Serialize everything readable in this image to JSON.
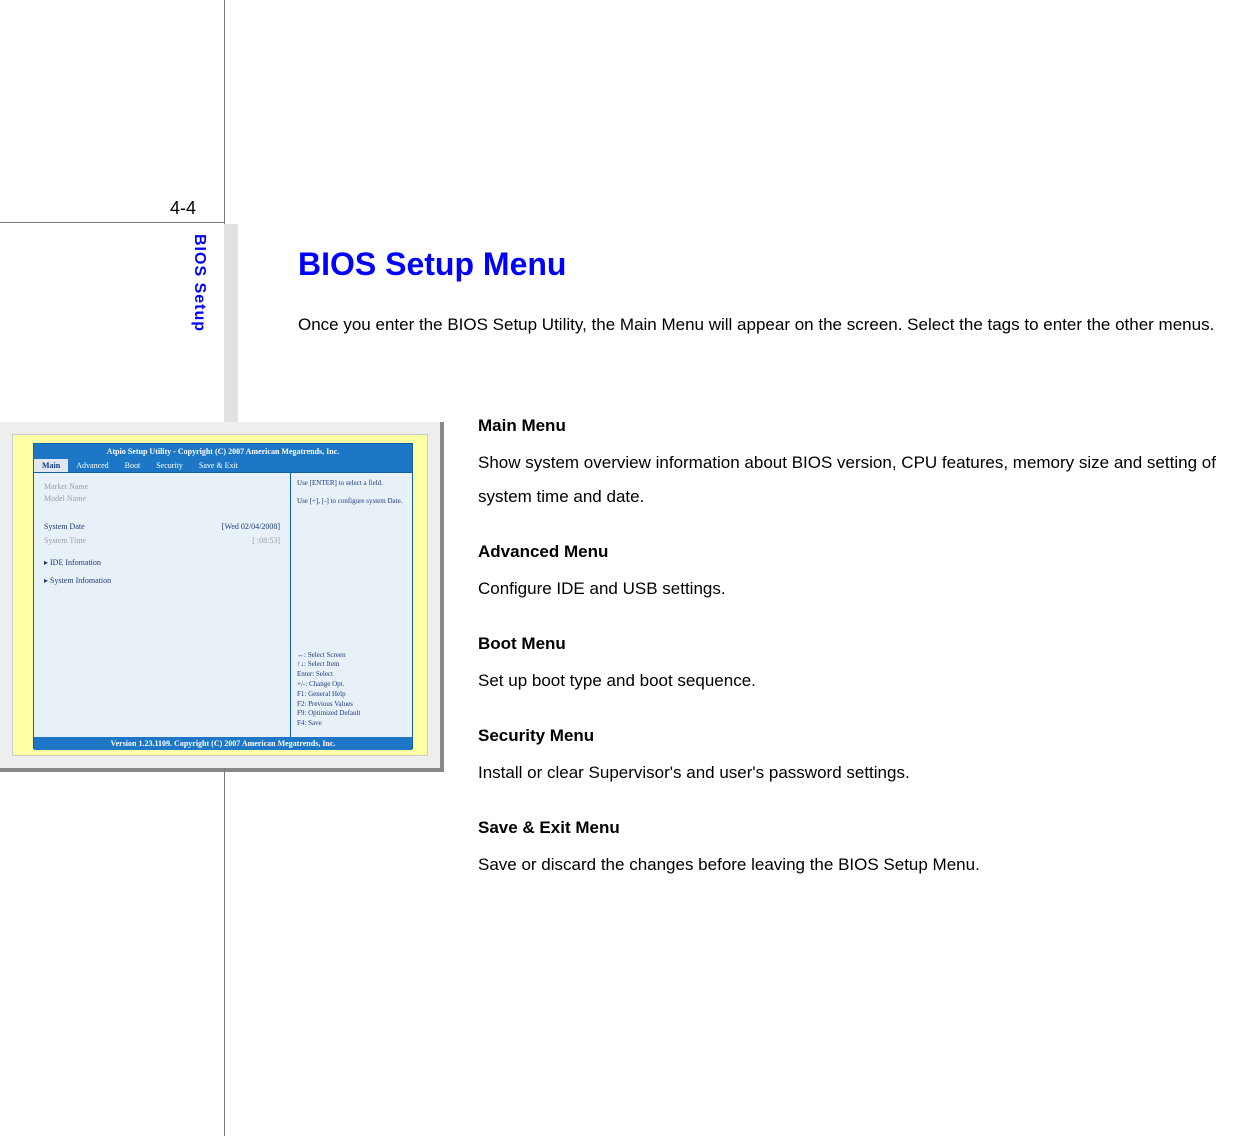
{
  "page_number": "4-4",
  "side_label": "BIOS Setup",
  "title": "BIOS Setup Menu",
  "intro": "Once you enter the BIOS Setup Utility, the Main Menu will appear on the screen.    Select the tags to enter the other menus.",
  "menus": [
    {
      "heading": "Main Menu",
      "text": "Show system overview information about BIOS version, CPU features, memory size and setting of system time and date."
    },
    {
      "heading": "Advanced Menu",
      "text": "Configure IDE and USB settings."
    },
    {
      "heading": "Boot Menu",
      "text": "Set up boot type and boot sequence."
    },
    {
      "heading": "Security Menu",
      "text": "Install or clear Supervisor's and user's password settings."
    },
    {
      "heading": "Save & Exit Menu",
      "text": "Save or discard the changes before leaving the BIOS Setup Menu."
    }
  ],
  "bios": {
    "title": "Atpio Setup Utility - Copyright (C) 2007 American Megatrends, Inc.",
    "tabs": [
      "Main",
      "Advanced",
      "Boot",
      "Security",
      "Save & Exit"
    ],
    "left": {
      "market": "Market Name",
      "model": "Model Name",
      "date_label": "System Date",
      "date_value": "[Wed 02/04/2008]",
      "time_label": "System Time",
      "time_value": "[   :08:53]",
      "sub1": "IDE Infomation",
      "sub2": "System Infomation"
    },
    "right": {
      "tip1": "Use [ENTER] to select a field.",
      "tip2": "Use [+], [-] to configure system Date.",
      "h1": "↔: Select Screen",
      "h2": "↑↓: Select Item",
      "h3": "Enter: Select",
      "h4": "+/-: Change Opt.",
      "h5": "F1: General Help",
      "h6": "F2: Previous Values",
      "h7": "F9: Optimized Default",
      "h8": "F4: Save"
    },
    "footer": "Version 1.23.1109. Copyright (C) 2007 American Megatrends, Inc."
  }
}
